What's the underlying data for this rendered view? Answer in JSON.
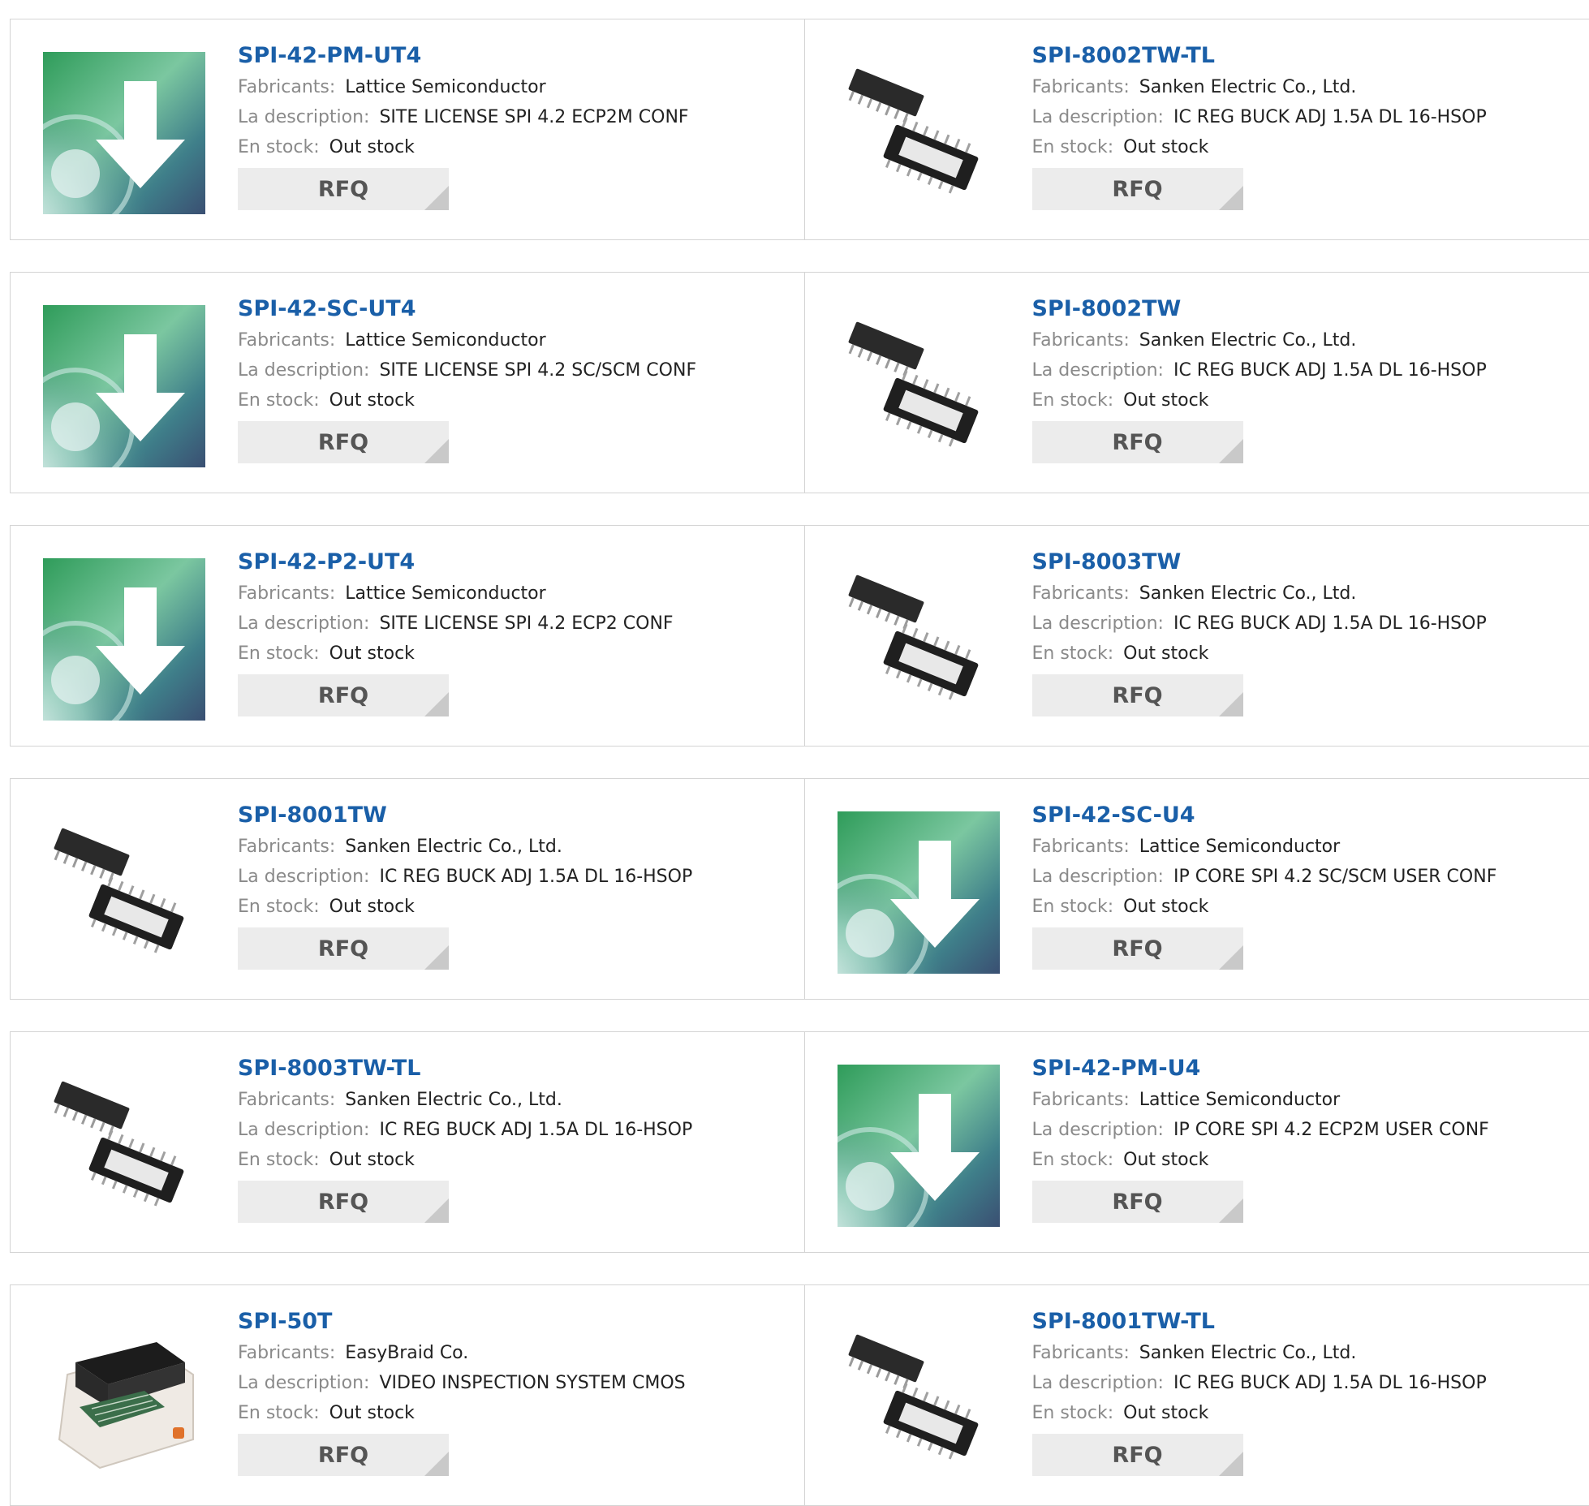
{
  "labels": {
    "manufacturer": "Fabricants:",
    "description": "La description:",
    "stock": "En stock:",
    "rfq": "RFQ"
  },
  "products": [
    {
      "part": "SPI-42-PM-UT4",
      "manufacturer": "Lattice Semiconductor",
      "description": "SITE LICENSE SPI 4.2 ECP2M CONF",
      "stock": "Out stock",
      "image": "software-download-disc-icon"
    },
    {
      "part": "SPI-8002TW-TL",
      "manufacturer": "Sanken Electric Co., Ltd.",
      "description": "IC REG BUCK ADJ 1.5A DL 16-HSOP",
      "stock": "Out stock",
      "image": "ic-chip-package-icon"
    },
    {
      "part": "SPI-42-SC-UT4",
      "manufacturer": "Lattice Semiconductor",
      "description": "SITE LICENSE SPI 4.2 SC/SCM CONF",
      "stock": "Out stock",
      "image": "software-download-disc-icon"
    },
    {
      "part": "SPI-8002TW",
      "manufacturer": "Sanken Electric Co., Ltd.",
      "description": "IC REG BUCK ADJ 1.5A DL 16-HSOP",
      "stock": "Out stock",
      "image": "ic-chip-package-icon"
    },
    {
      "part": "SPI-42-P2-UT4",
      "manufacturer": "Lattice Semiconductor",
      "description": "SITE LICENSE SPI 4.2 ECP2 CONF",
      "stock": "Out stock",
      "image": "software-download-disc-icon"
    },
    {
      "part": "SPI-8003TW",
      "manufacturer": "Sanken Electric Co., Ltd.",
      "description": "IC REG BUCK ADJ 1.5A DL 16-HSOP",
      "stock": "Out stock",
      "image": "ic-chip-package-icon"
    },
    {
      "part": "SPI-8001TW",
      "manufacturer": "Sanken Electric Co., Ltd.",
      "description": "IC REG BUCK ADJ 1.5A DL 16-HSOP",
      "stock": "Out stock",
      "image": "ic-chip-package-icon"
    },
    {
      "part": "SPI-42-SC-U4",
      "manufacturer": "Lattice Semiconductor",
      "description": "IP CORE SPI 4.2 SC/SCM USER CONF",
      "stock": "Out stock",
      "image": "software-download-disc-icon"
    },
    {
      "part": "SPI-8003TW-TL",
      "manufacturer": "Sanken Electric Co., Ltd.",
      "description": "IC REG BUCK ADJ 1.5A DL 16-HSOP",
      "stock": "Out stock",
      "image": "ic-chip-package-icon"
    },
    {
      "part": "SPI-42-PM-U4",
      "manufacturer": "Lattice Semiconductor",
      "description": "IP CORE SPI 4.2 ECP2M USER CONF",
      "stock": "Out stock",
      "image": "software-download-disc-icon"
    },
    {
      "part": "SPI-50T",
      "manufacturer": "EasyBraid Co.",
      "description": "VIDEO INSPECTION SYSTEM CMOS",
      "stock": "Out stock",
      "image": "inspection-machine-icon"
    },
    {
      "part": "SPI-8001TW-TL",
      "manufacturer": "Sanken Electric Co., Ltd.",
      "description": "IC REG BUCK ADJ 1.5A DL 16-HSOP",
      "stock": "Out stock",
      "image": "ic-chip-package-icon"
    }
  ],
  "colors": {
    "part_link": "#1a5fa8",
    "label_gray": "#8a8a8a",
    "border": "#d4d4d4",
    "rfq_bg": "#ececec"
  }
}
